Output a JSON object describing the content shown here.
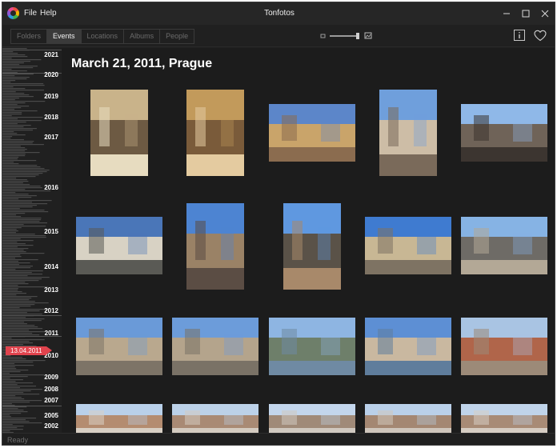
{
  "app": {
    "title": "Tonfotos"
  },
  "menu": {
    "file": "File",
    "help": "Help"
  },
  "tabs": [
    {
      "label": "Folders",
      "active": false
    },
    {
      "label": "Events",
      "active": true
    },
    {
      "label": "Locations",
      "active": false
    },
    {
      "label": "Albums",
      "active": false
    },
    {
      "label": "People",
      "active": false
    }
  ],
  "timeline": {
    "years": [
      "2021",
      "2020",
      "2019",
      "2018",
      "2017",
      "2016",
      "2015",
      "2014",
      "2013",
      "2012",
      "2011",
      "2010",
      "2009",
      "2008",
      "2007",
      "2005",
      "2002"
    ],
    "current_date": "13.04.2011"
  },
  "event": {
    "title": "March 21, 2011, Prague"
  },
  "photos": [
    {
      "subject": "statue-in-domed-hall",
      "colors": [
        "#c9b38a",
        "#6d5a43",
        "#e7dcc0"
      ]
    },
    {
      "subject": "statue-in-gilded-hall",
      "colors": [
        "#c29a5b",
        "#7a5b3a",
        "#e4cba0"
      ]
    },
    {
      "subject": "old-town-square-buildings",
      "colors": [
        "#5c86c9",
        "#c9a46a",
        "#8b6c4f"
      ]
    },
    {
      "subject": "ornate-corner-building",
      "colors": [
        "#6f9fdc",
        "#cdbda6",
        "#7a6a5a"
      ]
    },
    {
      "subject": "street-with-pedestrians",
      "colors": [
        "#8fb8e8",
        "#6f6358",
        "#3c3530"
      ]
    },
    {
      "subject": "arcade-with-bench",
      "colors": [
        "#4a76b8",
        "#d8d2c4",
        "#5a5a55"
      ]
    },
    {
      "subject": "tower-and-crowd",
      "colors": [
        "#4d84d2",
        "#9a8266",
        "#5b4d44"
      ]
    },
    {
      "subject": "tyn-church-spires",
      "colors": [
        "#5f98e0",
        "#5a5248",
        "#a8896a"
      ]
    },
    {
      "subject": "neo-renaissance-hall",
      "colors": [
        "#3f7bd0",
        "#c8b794",
        "#7e7363"
      ]
    },
    {
      "subject": "street-tram-tracks",
      "colors": [
        "#86b3e4",
        "#6e6b66",
        "#b3a896"
      ]
    },
    {
      "subject": "castle-view-walkway",
      "colors": [
        "#6a9ad8",
        "#b9a88e",
        "#7d7467"
      ]
    },
    {
      "subject": "castle-view-walkway-2",
      "colors": [
        "#6c9cda",
        "#b4a48c",
        "#7a7266"
      ]
    },
    {
      "subject": "river-and-hills",
      "colors": [
        "#8eb5e2",
        "#6e7f6a",
        "#6f8aa3"
      ]
    },
    {
      "subject": "river-embankment",
      "colors": [
        "#5d8fd4",
        "#c9b8a0",
        "#5f7d9c"
      ]
    },
    {
      "subject": "red-rooftops",
      "colors": [
        "#a9c4e3",
        "#b0654a",
        "#9c8a78"
      ]
    },
    {
      "subject": "city-panorama-1",
      "colors": [
        "#b9d0ea",
        "#b48c70",
        "#d8cfc4"
      ]
    },
    {
      "subject": "city-panorama-2",
      "colors": [
        "#bcd1e8",
        "#a98a74",
        "#d4cbc0"
      ]
    },
    {
      "subject": "city-panorama-3",
      "colors": [
        "#c3d6ec",
        "#a08a78",
        "#d0c9c0"
      ]
    },
    {
      "subject": "city-panorama-4",
      "colors": [
        "#bad0e9",
        "#a48772",
        "#cfc6bc"
      ]
    },
    {
      "subject": "city-panorama-5",
      "colors": [
        "#c0d4ea",
        "#a88b76",
        "#d6cdc3"
      ]
    }
  ],
  "status": {
    "text": "Ready"
  }
}
